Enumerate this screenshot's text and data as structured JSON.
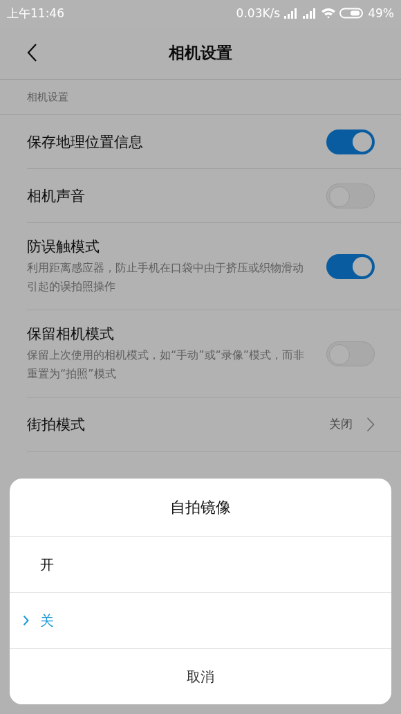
{
  "status_bar": {
    "time": "上午11:46",
    "net_speed": "0.03K/s",
    "battery": "49%"
  },
  "header": {
    "title": "相机设置"
  },
  "section_label": "相机设置",
  "settings": [
    {
      "kind": "toggle",
      "title": "保存地理位置信息",
      "on": true
    },
    {
      "kind": "toggle",
      "title": "相机声音",
      "on": false
    },
    {
      "kind": "toggle",
      "title": "防误触模式",
      "description": "利用距离感应器，防止手机在口袋中由于挤压或织物滑动引起的误拍照操作",
      "on": true
    },
    {
      "kind": "toggle",
      "title": "保留相机模式",
      "description": "保留上次使用的相机模式，如“手动”或“录像”模式，而非重置为“拍照”模式",
      "on": false
    },
    {
      "kind": "link",
      "title": "街拍模式",
      "value": "关闭"
    }
  ],
  "dialog": {
    "title": "自拍镜像",
    "options": [
      {
        "label": "开",
        "selected": false
      },
      {
        "label": "关",
        "selected": true
      }
    ],
    "cancel": "取消"
  }
}
